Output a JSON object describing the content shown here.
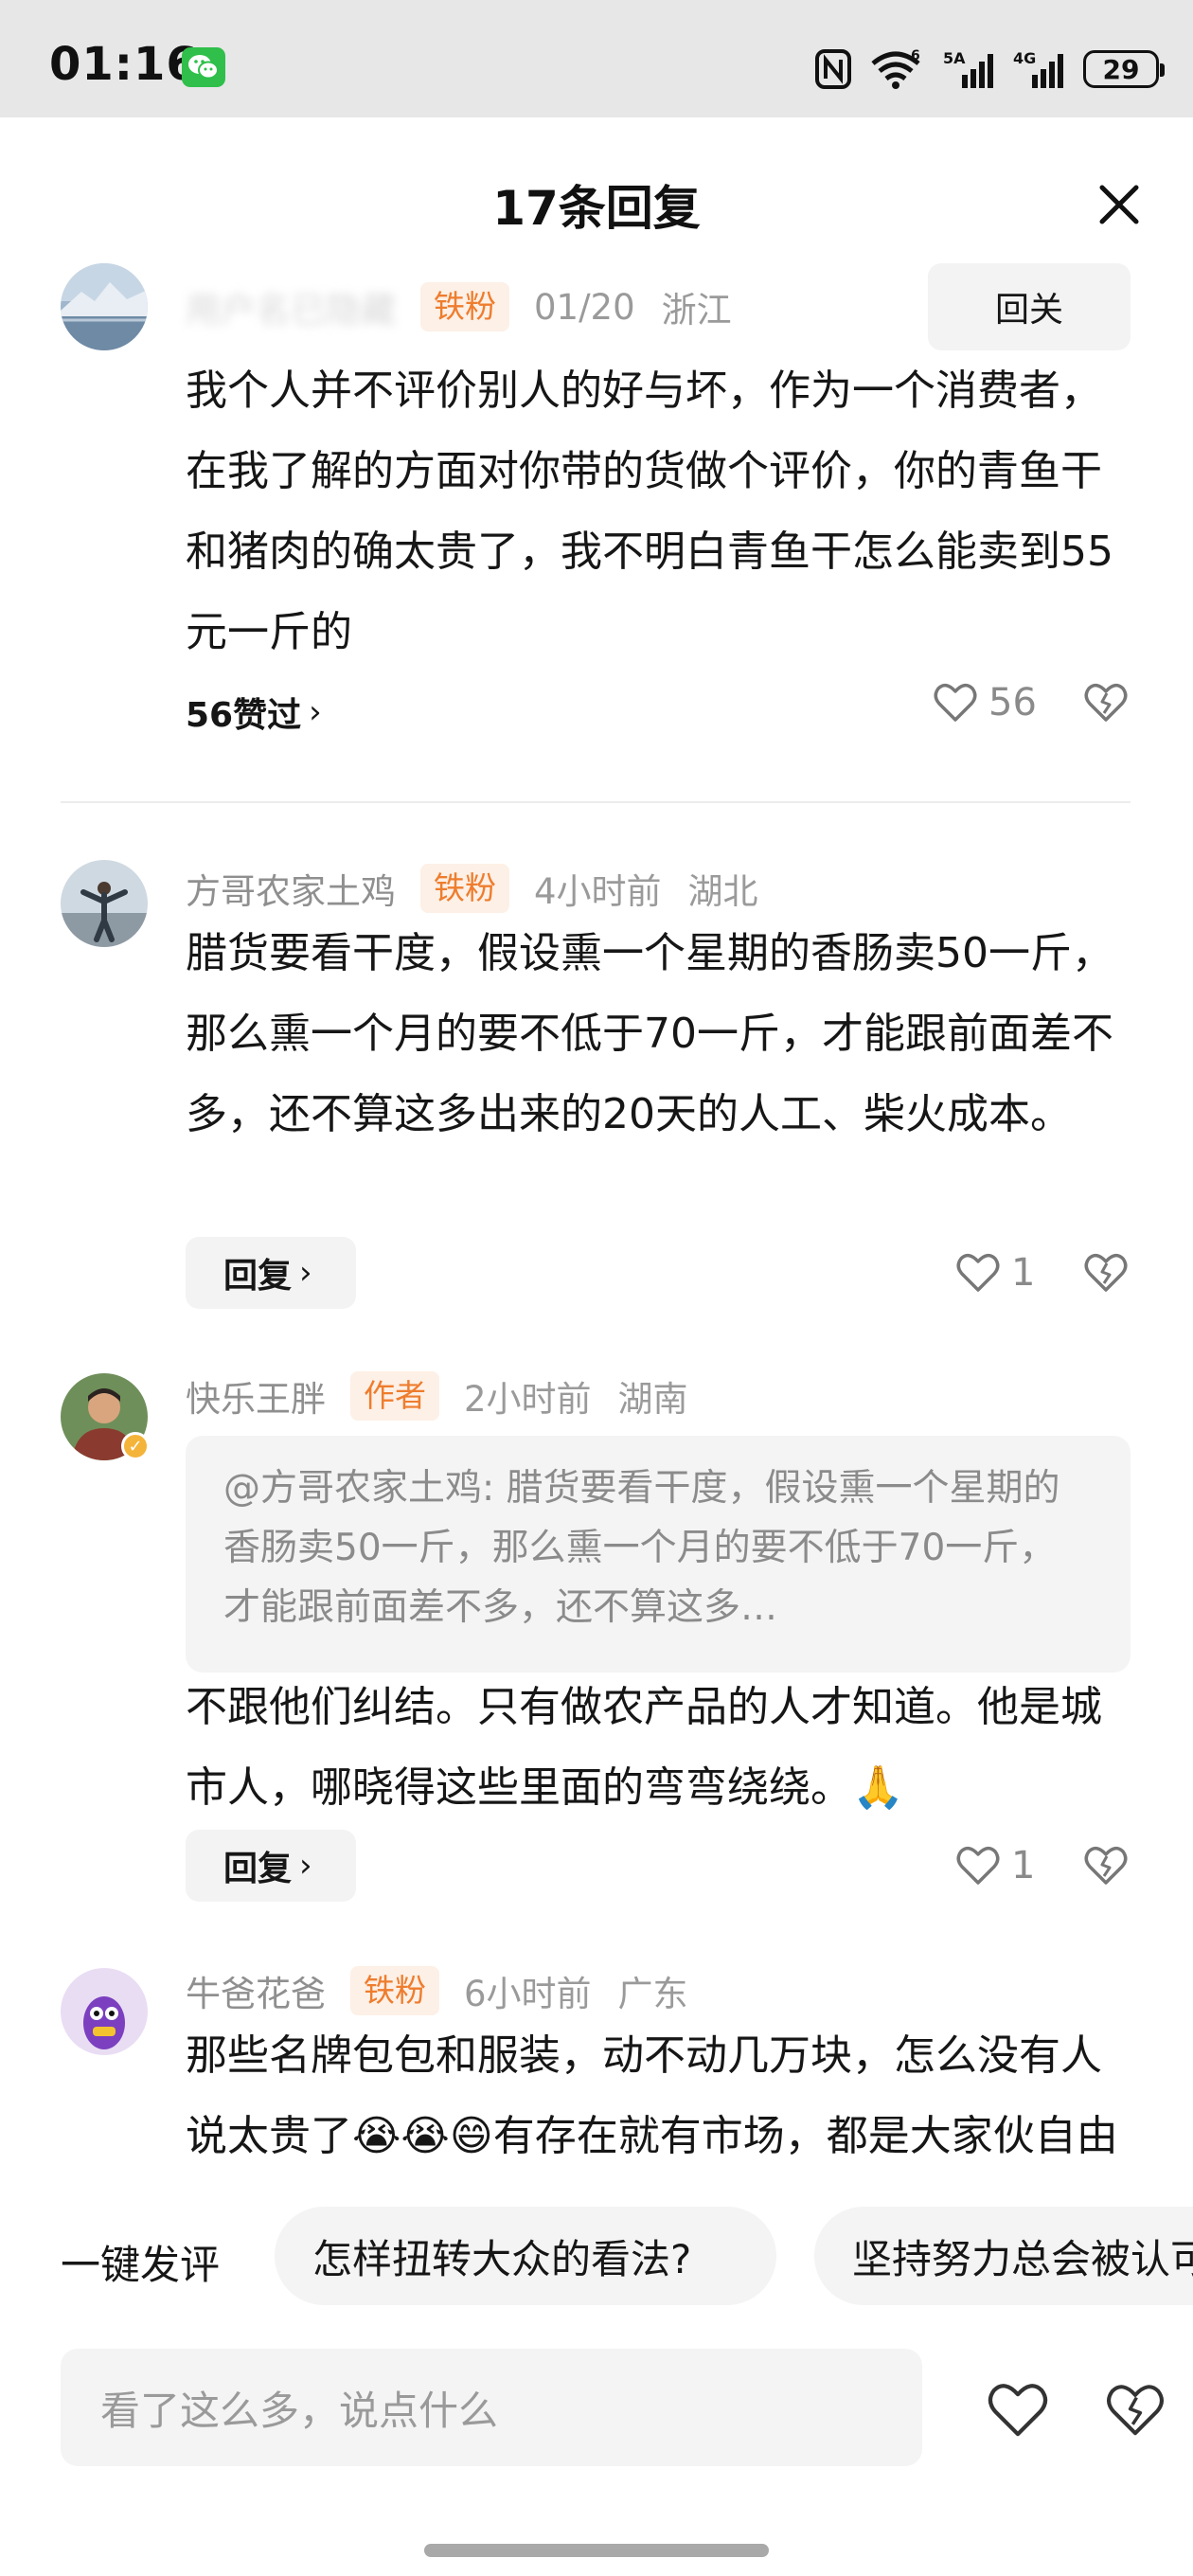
{
  "status_bar": {
    "time": "01:16",
    "signal_1": "6",
    "signal_2": "5A",
    "signal_3": "4G",
    "battery": "29"
  },
  "sheet": {
    "title": "17条回复"
  },
  "comments": [
    {
      "username": "用户名已隐藏",
      "badge": "铁粉",
      "time": "01/20",
      "location": "浙江",
      "follow_label": "回关",
      "text": "我个人并不评价别人的好与坏，作为一个消费者，在我了解的方面对你带的货做个评价，你的青鱼干和猪肉的确太贵了，我不明白青鱼干怎么能卖到55元一斤的",
      "liked_by": "56赞过",
      "likes": "56"
    },
    {
      "username": "方哥农家土鸡",
      "badge": "铁粉",
      "time": "4小时前",
      "location": "湖北",
      "text": "腊货要看干度，假设熏一个星期的香肠卖50一斤，那么熏一个月的要不低于70一斤，才能跟前面差不多，还不算这多出来的20天的人工、柴火成本。",
      "reply_label": "回复",
      "likes": "1"
    },
    {
      "username": "快乐王胖",
      "badge": "作者",
      "time": "2小时前",
      "location": "湖南",
      "quote": "@方哥农家土鸡: 腊货要看干度，假设熏一个星期的香肠卖50一斤，那么熏一个月的要不低于70一斤，才能跟前面差不多，还不算这多…",
      "text": "不跟他们纠结。只有做农产品的人才知道。他是城市人，哪晓得这些里面的弯弯绕绕。🙏",
      "reply_label": "回复",
      "likes": "1"
    },
    {
      "username": "牛爸花爸",
      "badge": "铁粉",
      "time": "6小时前",
      "location": "广东",
      "text": "那些名牌包包和服装，动不动几万块，怎么没有人说太贵了😭😭😄有存在就有市场，都是大家伙自由"
    }
  ],
  "quick_reply": {
    "label": "一键发评",
    "chips": [
      "怎样扭转大众的看法?",
      "坚持努力总会被认可"
    ]
  },
  "input": {
    "placeholder": "看了这么多，说点什么"
  },
  "colors": {
    "accent_orange": "#ee7d2e",
    "badge_bg": "#fdf0e6",
    "status_bar_bg": "#e7e7e7"
  }
}
